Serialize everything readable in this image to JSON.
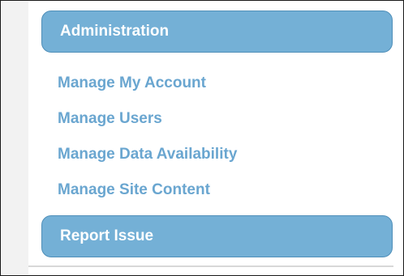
{
  "sidebar": {
    "administration": {
      "label": "Administration",
      "items": [
        {
          "label": "Manage My Account"
        },
        {
          "label": "Manage Users"
        },
        {
          "label": "Manage Data Availability"
        },
        {
          "label": "Manage Site Content"
        }
      ]
    },
    "report_issue": {
      "label": "Report Issue"
    }
  },
  "colors": {
    "header_background": "#74b0d6",
    "header_border": "#4f8fb9",
    "header_text": "#ffffff",
    "link_text": "#6aa6d0",
    "rail_background": "#f2f2f2"
  }
}
